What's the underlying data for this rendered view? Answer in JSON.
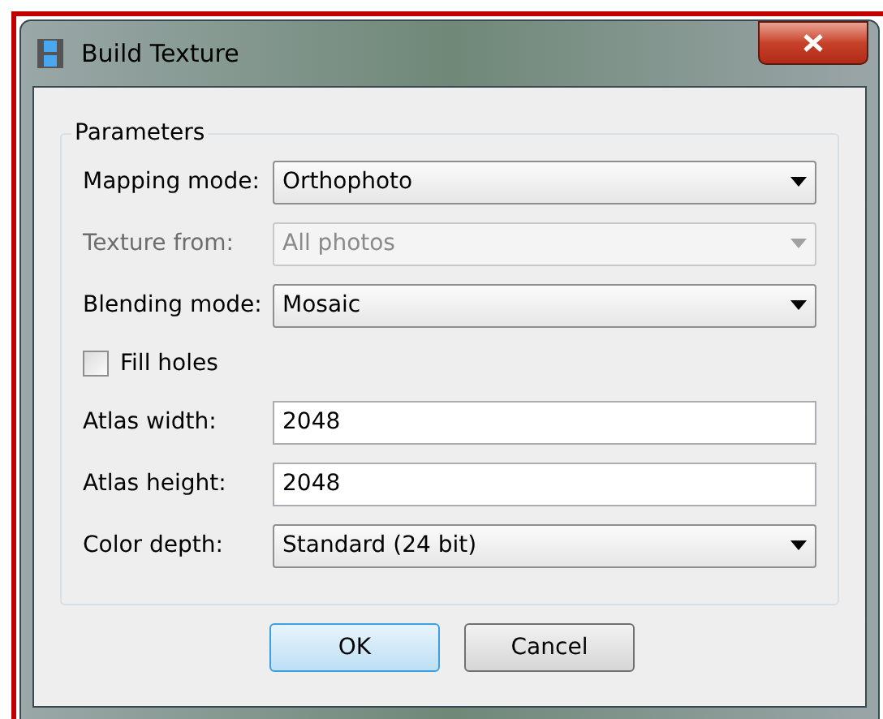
{
  "window": {
    "title": "Build Texture"
  },
  "group": {
    "title": "Parameters"
  },
  "rows": [
    {
      "kind": "dropdown",
      "label": "Mapping mode:",
      "value": "Orthophoto",
      "disabled": false
    },
    {
      "kind": "dropdown",
      "label": "Texture from:",
      "value": "All photos",
      "disabled": true
    },
    {
      "kind": "dropdown",
      "label": "Blending mode:",
      "value": "Mosaic",
      "disabled": false
    },
    {
      "kind": "checkbox",
      "label": "Fill holes",
      "checked": false
    },
    {
      "kind": "field",
      "label": "Atlas width:",
      "value": "2048"
    },
    {
      "kind": "field",
      "label": "Atlas height:",
      "value": "2048"
    },
    {
      "kind": "dropdown",
      "label": "Color depth:",
      "value": "Standard (24 bit)",
      "disabled": false
    }
  ],
  "buttons": [
    {
      "label": "OK",
      "default": true
    },
    {
      "label": "Cancel",
      "default": false
    }
  ]
}
